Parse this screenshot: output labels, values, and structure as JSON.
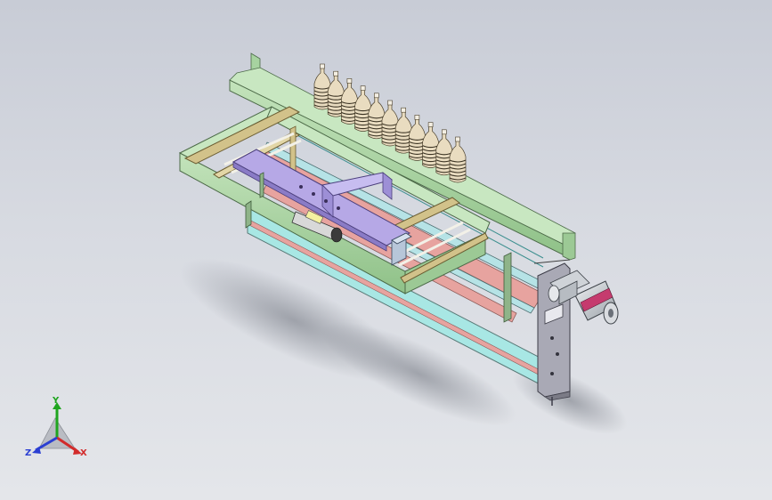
{
  "viewport": {
    "background_top": "#c8ccd6",
    "background_bottom": "#e4e6ea"
  },
  "model": {
    "bottle_count": 11,
    "frame_color": "#a7d3a0",
    "rail_color": "#b6e3e6",
    "slide_color": "#b6a8e6",
    "belt_color": "#e7a39f",
    "wood_color": "#d2c28a",
    "bottle_color": "#e9dcc0",
    "motor_color": "#cfd3d8",
    "motor_band_color": "#c53b6e",
    "plate_color": "#a9a9b5"
  },
  "triad": {
    "x_label": "X",
    "y_label": "Y",
    "z_label": "Z",
    "x_color": "#d22b2b",
    "y_color": "#1fa51f",
    "z_color": "#2b3fd2"
  }
}
